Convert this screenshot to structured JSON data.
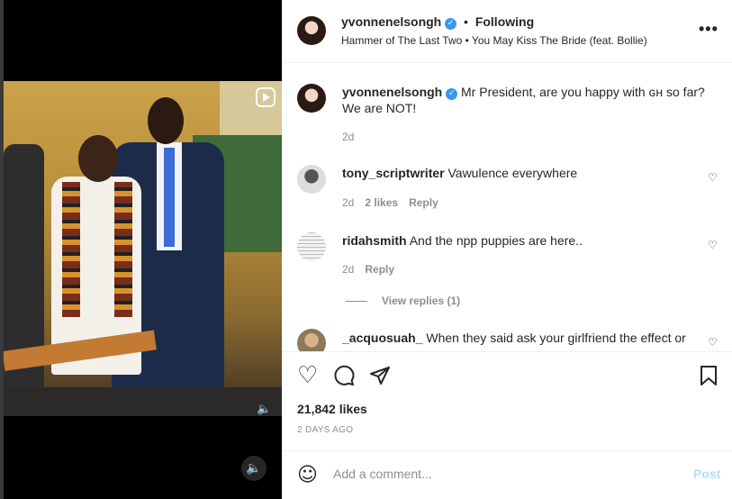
{
  "header": {
    "username": "yvonnenelsongh",
    "separator": "•",
    "follow_status": "Following",
    "audio": "Hammer of The Last Two • You May Kiss The Bride (feat. Bollie)",
    "more_icon": "more-horizontal-icon"
  },
  "caption": {
    "username": "yvonnenelsongh",
    "text": "Mr President, are you happy with ɢʜ so far? We are NOT!",
    "time": "2d"
  },
  "comments": [
    {
      "username": "tony_scriptwriter",
      "text": "Vawulence everywhere",
      "time": "2d",
      "likes": "2 likes",
      "reply": "Reply"
    },
    {
      "username": "ridahsmith",
      "text": "And the npp puppies are here..",
      "time": "2d",
      "reply": "Reply",
      "view_replies": "View replies (1)"
    },
    {
      "username": "_acquosuah_",
      "text": "When they said ask your girlfriend the effect or"
    }
  ],
  "post": {
    "likes": "21,842 likes",
    "date": "2 DAYS AGO"
  },
  "composer": {
    "placeholder": "Add a comment...",
    "post_label": "Post"
  },
  "colors": {
    "verified": "#3897f0",
    "post_disabled": "#b2dffc"
  }
}
